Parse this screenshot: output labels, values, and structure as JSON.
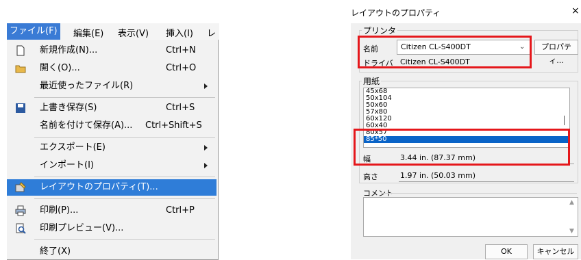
{
  "menubar": {
    "file": "ファイル(F)",
    "edit": "編集(E)",
    "view": "表示(V)",
    "insert": "挿入(I)",
    "layout_partial": "レイ"
  },
  "file_menu": {
    "new": {
      "label": "新規作成(N)...",
      "shortcut": "Ctrl+N"
    },
    "open": {
      "label": "開く(O)...",
      "shortcut": "Ctrl+O"
    },
    "recent": {
      "label": "最近使ったファイル(R)"
    },
    "save": {
      "label": "上書き保存(S)",
      "shortcut": "Ctrl+S"
    },
    "save_as": {
      "label": "名前を付けて保存(A)...",
      "shortcut": "Ctrl+Shift+S"
    },
    "export": {
      "label": "エクスポート(E)"
    },
    "import": {
      "label": "インポート(I)"
    },
    "layout_props": {
      "label": "レイアウトのプロパティ(T)..."
    },
    "print": {
      "label": "印刷(P)...",
      "shortcut": "Ctrl+P"
    },
    "print_preview": {
      "label": "印刷プレビュー(V)..."
    },
    "exit": {
      "label": "終了(X)"
    }
  },
  "dialog": {
    "title": "レイアウトのプロパティ",
    "close": "×",
    "printer_group": "プリンタ",
    "name_label": "名前",
    "printer_name": "Citizen CL-S400DT",
    "properties_button": "プロパティ...",
    "driver_label": "ドライバ",
    "driver_name": "Citizen CL-S400DT",
    "paper_group": "用紙",
    "paper_sizes": [
      "45x68",
      "50x104",
      "50x60",
      "57x80",
      "60x120",
      "60x40",
      "80x57",
      "85*50"
    ],
    "selected_paper": "85*50",
    "width_label": "幅",
    "width_value": "3.44 in. (87.37 mm)",
    "height_label": "高さ",
    "height_value": "1.97 in. (50.03 mm)",
    "comment_label": "コメント",
    "ok_button": "OK",
    "cancel_button": "キャンセル"
  },
  "colors": {
    "highlight": "#2f7dd8",
    "annotation": "#e5171b"
  }
}
